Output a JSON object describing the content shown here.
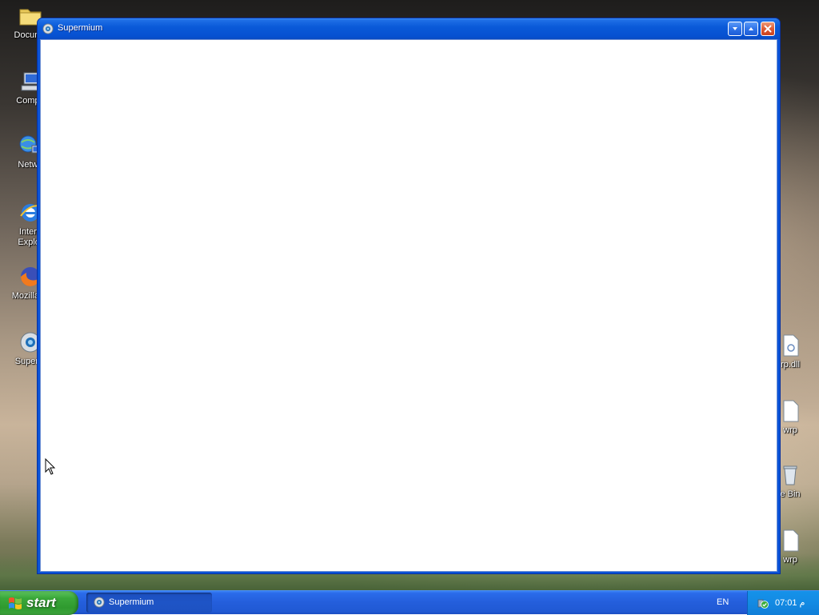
{
  "desktop": {
    "left_icons": [
      {
        "label": "Docume",
        "icon": "folder-icon"
      },
      {
        "label": "Compu",
        "icon": "computer-icon"
      },
      {
        "label": "Netwo",
        "icon": "network-icon"
      },
      {
        "label": "Intern\nExplor",
        "icon": "internet-explorer-icon"
      },
      {
        "label": "Mozilla Fi",
        "icon": "firefox-icon"
      },
      {
        "label": "Superm",
        "icon": "supermium-icon"
      }
    ],
    "right_icons": [
      {
        "label": "rp.dll",
        "icon": "dll-file-icon"
      },
      {
        "label": "wrp",
        "icon": "file-icon"
      },
      {
        "label": "e Bin",
        "icon": "recycle-bin-icon"
      },
      {
        "label": "wrp",
        "icon": "file-icon"
      }
    ]
  },
  "window": {
    "title": "Supermium",
    "icon": "supermium-icon",
    "buttons": {
      "minimize": "minimize-icon",
      "maximize": "maximize-icon",
      "close": "close-icon"
    }
  },
  "taskbar": {
    "start_label": "start",
    "task_item_label": "Supermium",
    "language": "EN",
    "clock": "07:01 ﻡ"
  },
  "colors": {
    "taskbar_blue": "#245edb",
    "start_green": "#3aa83a",
    "tray_blue": "#138ae3",
    "close_red": "#df5b35"
  }
}
